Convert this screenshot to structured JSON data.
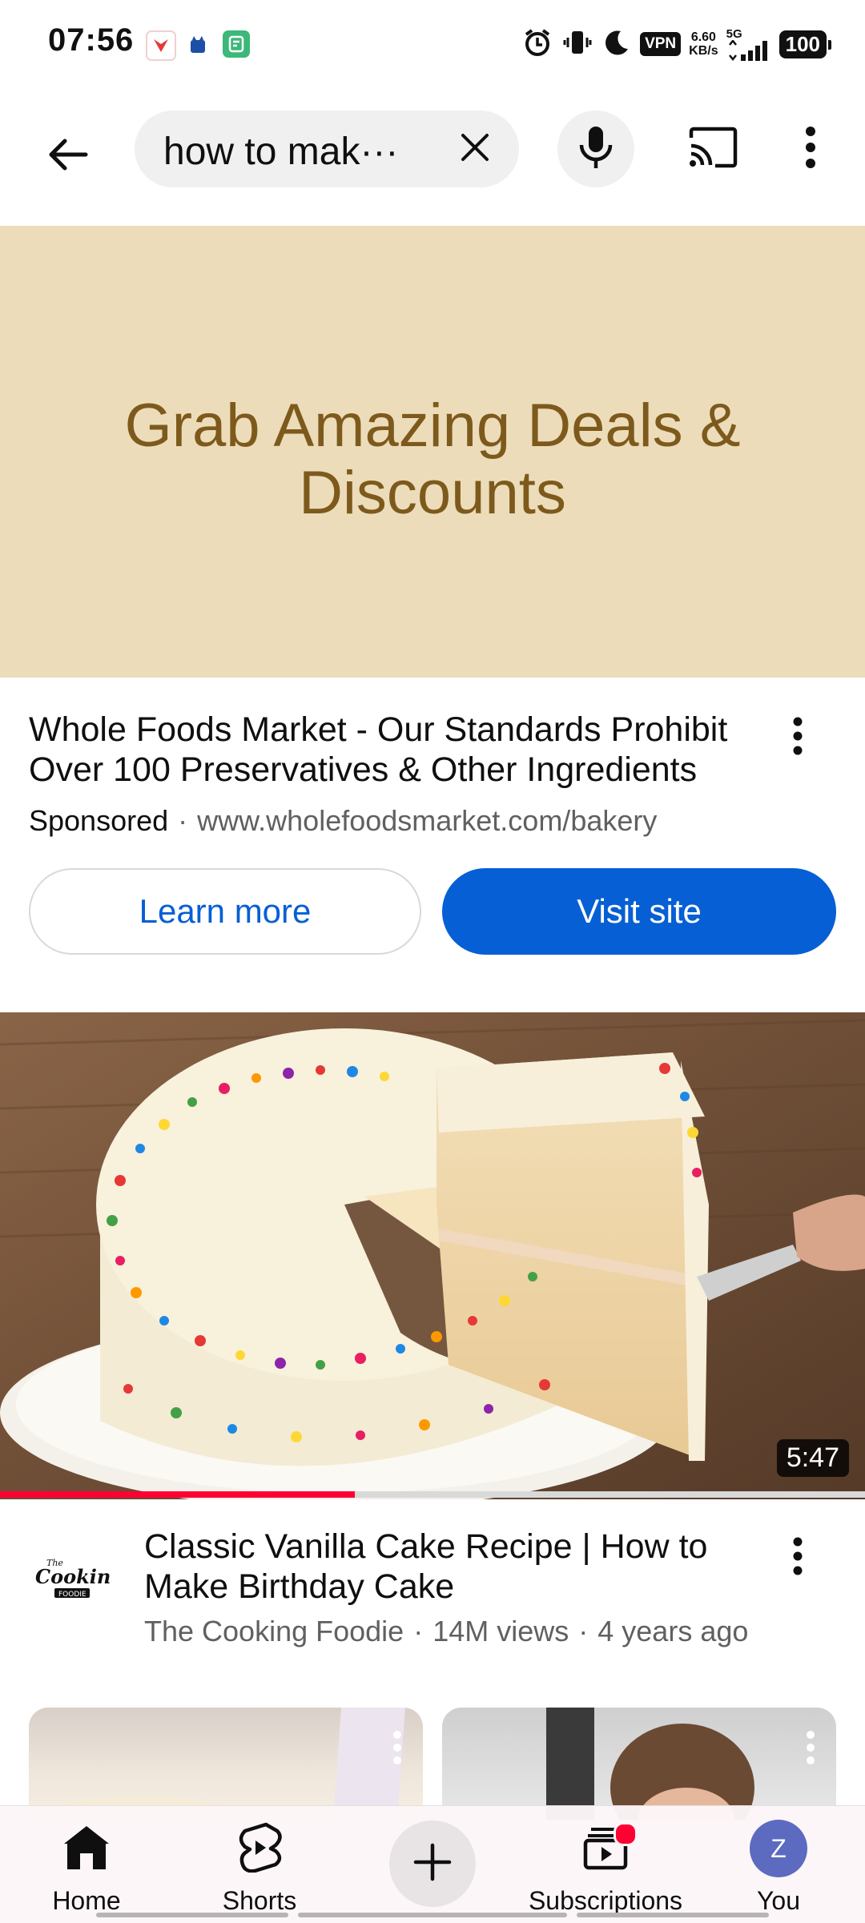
{
  "status_bar": {
    "time": "07:56",
    "vpn": "VPN",
    "net_speed_value": "6.60",
    "net_speed_unit": "KB/s",
    "network": "5G",
    "battery": "100"
  },
  "top_bar": {
    "search_query": "how to mak···",
    "icons": [
      "back-arrow-icon",
      "close-icon",
      "mic-icon",
      "cast-icon",
      "more-vert-icon"
    ]
  },
  "ad": {
    "banner_headline": "Grab Amazing Deals & Discounts",
    "title": "Whole Foods Market - Our Standards Prohibit Over 100 Preservatives & Other Ingredients",
    "sponsored": "Sponsored",
    "separator": "·",
    "url": "www.wholefoodsmarket.com/bakery",
    "learn_more": "Learn more",
    "visit_site": "Visit site",
    "colors": {
      "banner_bg": "#ecdcba",
      "banner_text": "#7d5a1c",
      "accent": "#065fd4"
    }
  },
  "video": {
    "duration": "5:47",
    "progress_fraction": 0.41,
    "title": "Classic Vanilla Cake Recipe | How to Make Birthday Cake",
    "channel": "The Cooking Foodie",
    "views": "14M views",
    "age": "4 years ago",
    "separator": "·",
    "avatar_text_top": "The",
    "avatar_text_main": "Cooking",
    "avatar_text_sub": "FOODIE",
    "colors": {
      "progress": "#ff0033"
    }
  },
  "bottom_nav": {
    "items": [
      {
        "label": "Home",
        "icon": "home-icon"
      },
      {
        "label": "Shorts",
        "icon": "shorts-icon"
      },
      {
        "label": "",
        "icon": "plus-icon"
      },
      {
        "label": "Subscriptions",
        "icon": "subscriptions-icon"
      },
      {
        "label": "You",
        "icon": "avatar"
      }
    ],
    "avatar_letter": "Z"
  }
}
